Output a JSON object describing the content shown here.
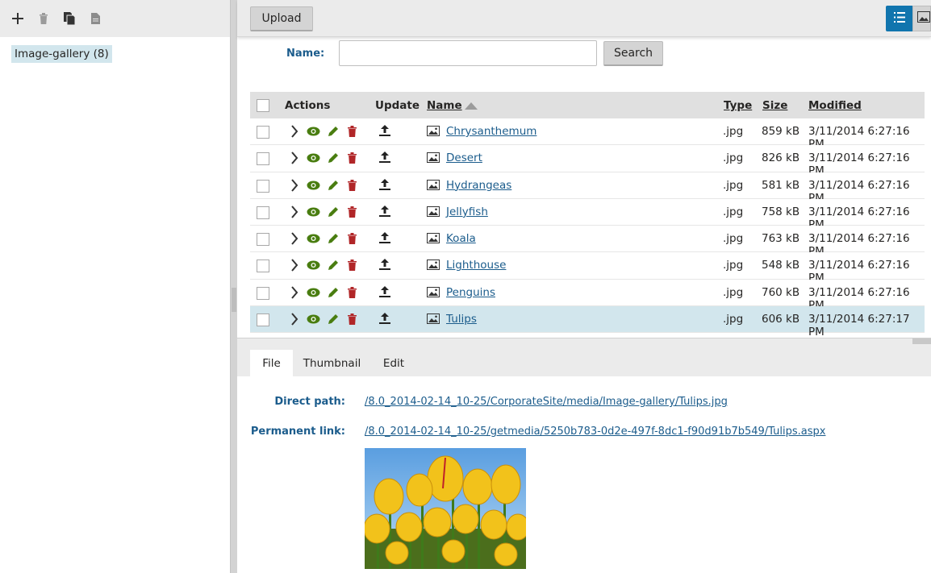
{
  "left_panel": {
    "toolbar": {
      "new_icon": "plus-icon",
      "delete_icon": "trash-icon",
      "copy_icon": "copy-icon",
      "move_icon": "file-icon"
    },
    "tree_root_label": "Image-gallery (8)"
  },
  "toolbar": {
    "upload_label": "Upload",
    "view_list_icon": "list-view-icon",
    "view_tiles_icon": "tiles-view-icon"
  },
  "filter": {
    "name_label": "Name:",
    "name_value": "",
    "search_label": "Search"
  },
  "grid": {
    "headers": {
      "actions": "Actions",
      "update": "Update",
      "name": "Name",
      "type": "Type",
      "size": "Size",
      "modified": "Modified"
    },
    "sort": {
      "column": "Name",
      "direction": "ascending"
    },
    "rows": [
      {
        "name": "Chrysanthemum",
        "type": ".jpg",
        "size": "859 kB",
        "modified": "3/11/2014 6:27:16 PM"
      },
      {
        "name": "Desert",
        "type": ".jpg",
        "size": "826 kB",
        "modified": "3/11/2014 6:27:16 PM"
      },
      {
        "name": "Hydrangeas",
        "type": ".jpg",
        "size": "581 kB",
        "modified": "3/11/2014 6:27:16 PM"
      },
      {
        "name": "Jellyfish",
        "type": ".jpg",
        "size": "758 kB",
        "modified": "3/11/2014 6:27:16 PM"
      },
      {
        "name": "Koala",
        "type": ".jpg",
        "size": "763 kB",
        "modified": "3/11/2014 6:27:16 PM"
      },
      {
        "name": "Lighthouse",
        "type": ".jpg",
        "size": "548 kB",
        "modified": "3/11/2014 6:27:16 PM"
      },
      {
        "name": "Penguins",
        "type": ".jpg",
        "size": "760 kB",
        "modified": "3/11/2014 6:27:16 PM"
      },
      {
        "name": "Tulips",
        "type": ".jpg",
        "size": "606 kB",
        "modified": "3/11/2014 6:27:17 PM",
        "selected": true
      }
    ]
  },
  "detail": {
    "tabs": [
      "File",
      "Thumbnail",
      "Edit"
    ],
    "active_tab": "File",
    "direct_path_label": "Direct path:",
    "direct_path_value": "/8.0_2014-02-14_10-25/CorporateSite/media/Image-gallery/Tulips.jpg",
    "permanent_link_label": "Permanent link:",
    "permanent_link_value": "/8.0_2014-02-14_10-25/getmedia/5250b783-0d2e-497f-8dc1-f90d91b7b549/Tulips.aspx"
  },
  "colors": {
    "accent": "#1175ae",
    "link": "#1b5c8c",
    "selected_row": "#d2e6ed",
    "view_icon": "#497d10",
    "edit_icon": "#497d10",
    "delete_icon": "#b12628"
  }
}
